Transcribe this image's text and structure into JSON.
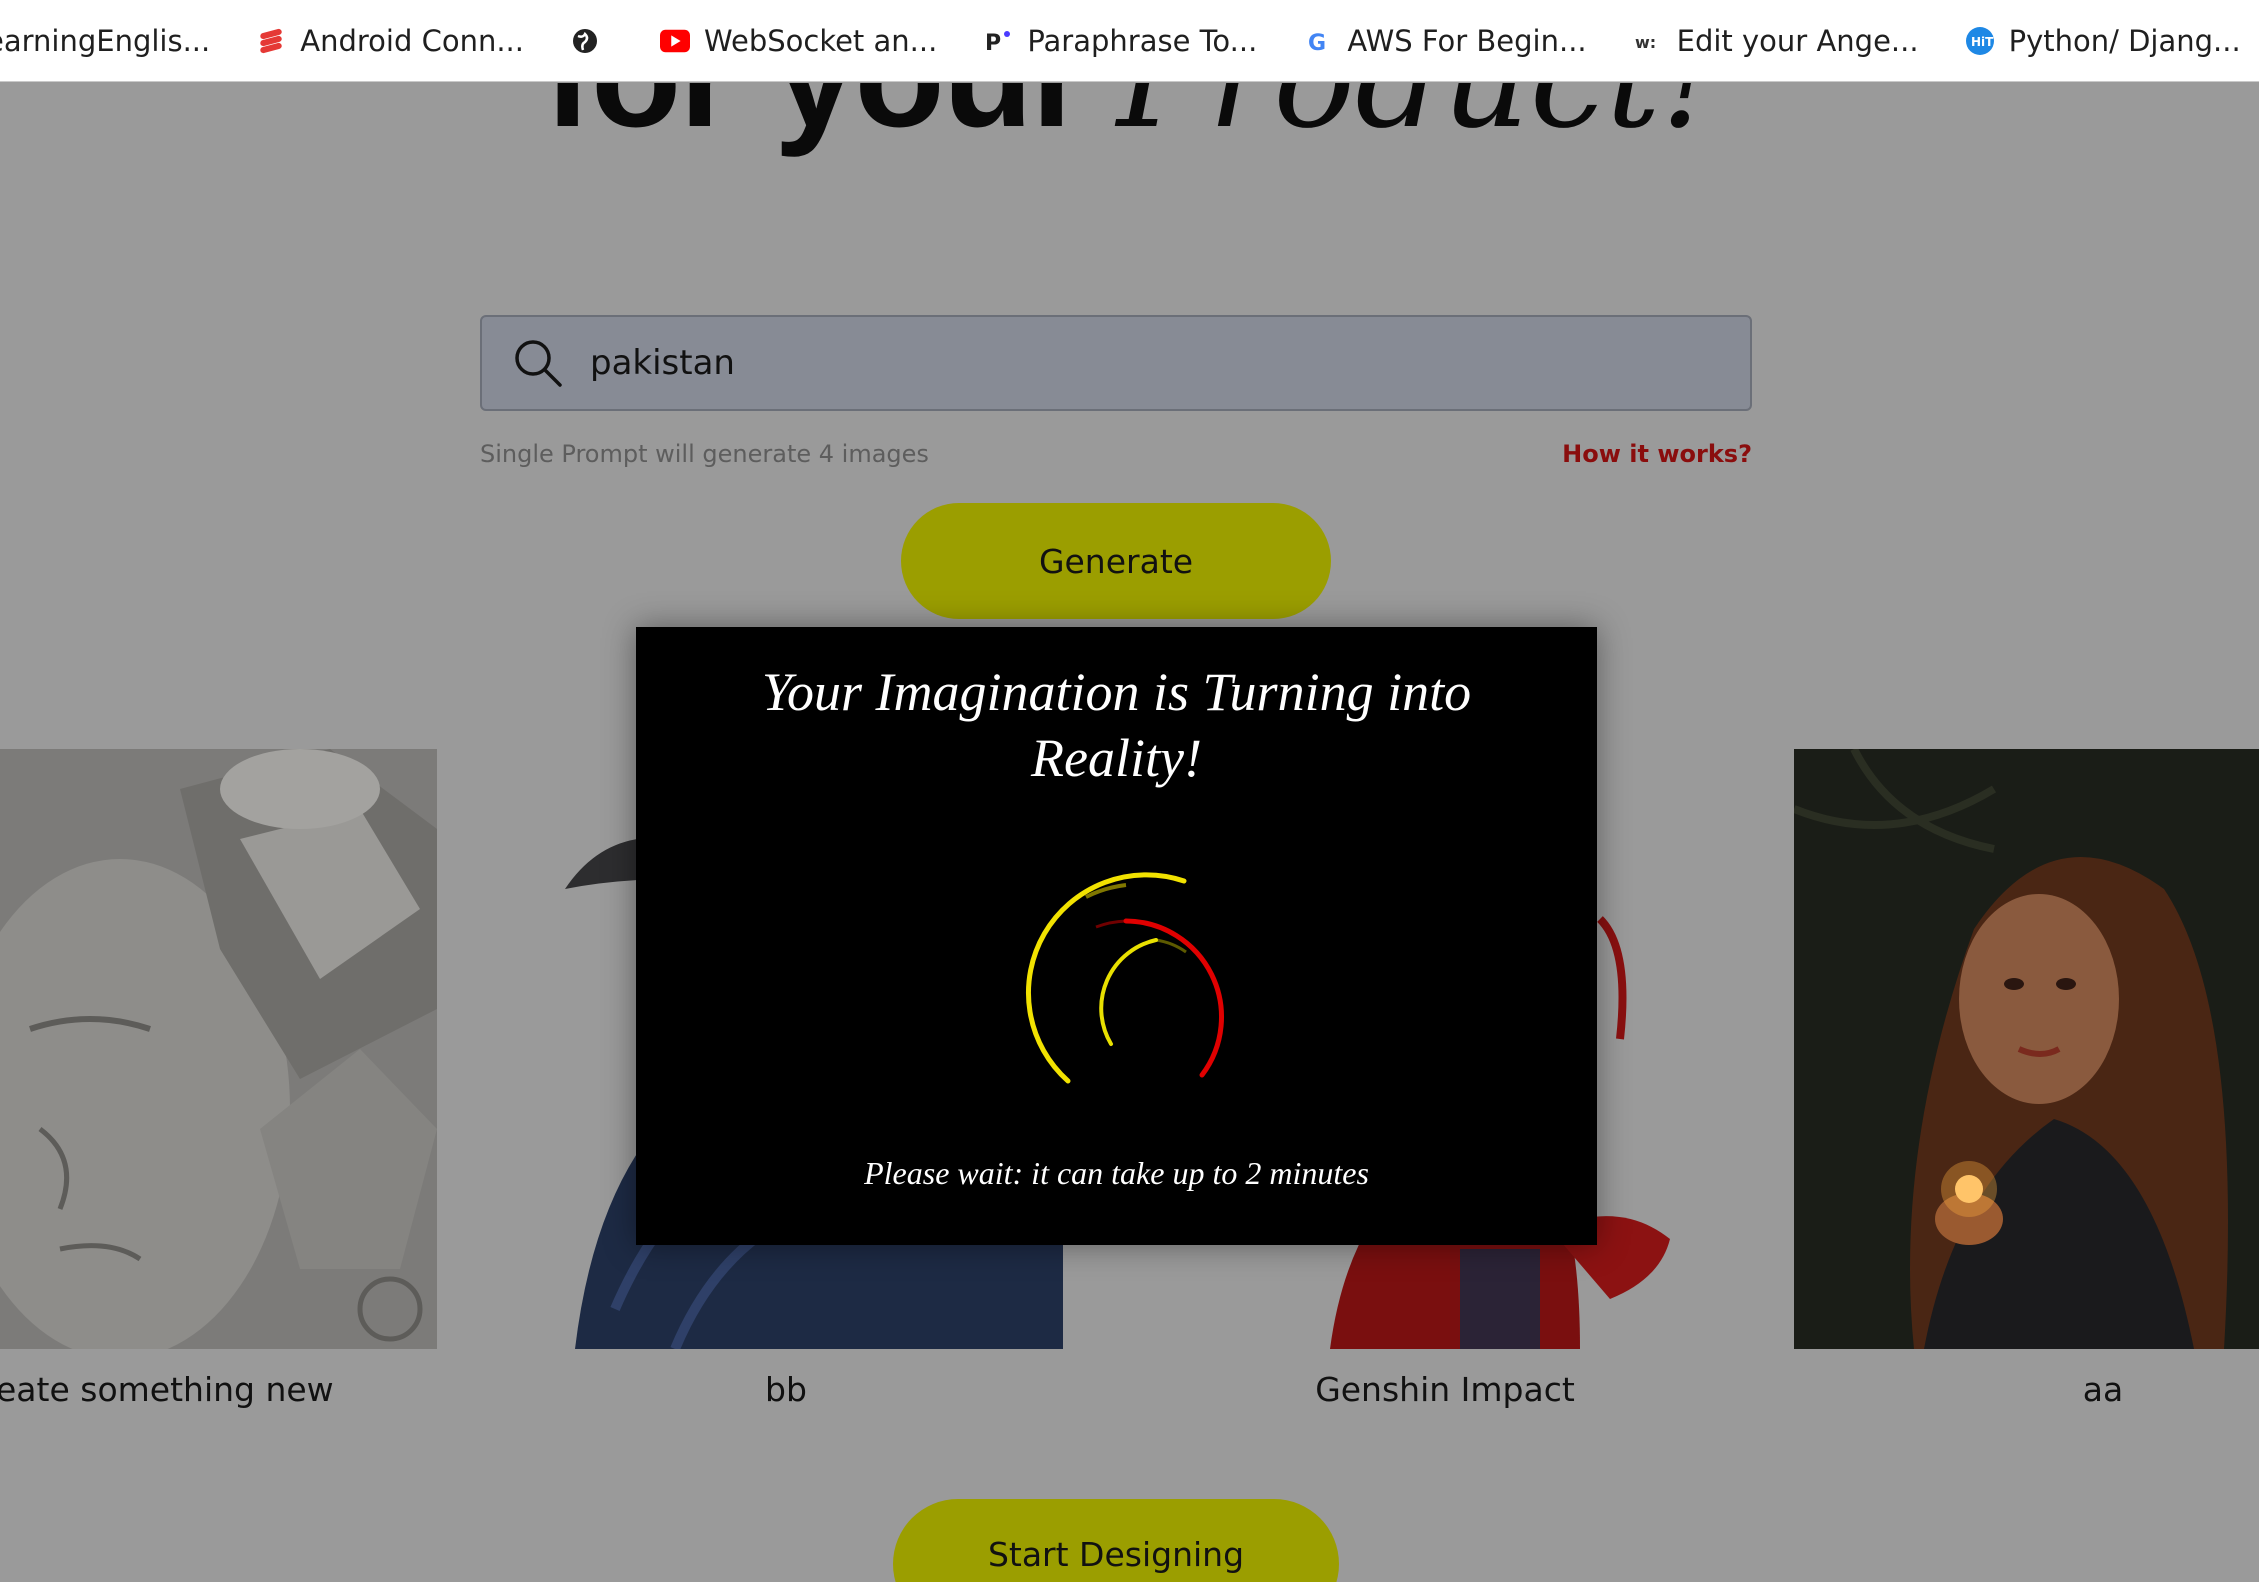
{
  "bookmarks": [
    {
      "label": "earningEnglis...",
      "icon": "blank-icon"
    },
    {
      "label": "Android Conn...",
      "icon": "stack-icon"
    },
    {
      "label": "",
      "icon": "globe-icon"
    },
    {
      "label": "WebSocket an...",
      "icon": "youtube-icon"
    },
    {
      "label": "Paraphrase To...",
      "icon": "paraphrase-icon"
    },
    {
      "label": "AWS For Begin...",
      "icon": "google-icon"
    },
    {
      "label": "Edit your Ange...",
      "icon": "w-icon"
    },
    {
      "label": "Python/ Djang...",
      "icon": "hit-icon"
    }
  ],
  "hero": {
    "plain": "for your",
    "script": "Product!"
  },
  "search": {
    "value": "pakistan"
  },
  "hint": "Single Prompt will generate 4 images",
  "how_link": "How it works?",
  "generate_label": "Generate",
  "gallery": [
    {
      "label": "eate something new"
    },
    {
      "label": "bb"
    },
    {
      "label": "Genshin Impact"
    },
    {
      "label": "aa"
    }
  ],
  "start_label": "Start Designing",
  "modal": {
    "title": "Your Imagination is Turning into Reality!",
    "wait": "Please wait: it can take up to 2 minutes"
  },
  "colors": {
    "accent": "#9b9e00",
    "link": "#8a0d0d",
    "spinner_outer": "#ffee00",
    "spinner_mid": "#e00000",
    "spinner_inner": "#e8e000"
  }
}
